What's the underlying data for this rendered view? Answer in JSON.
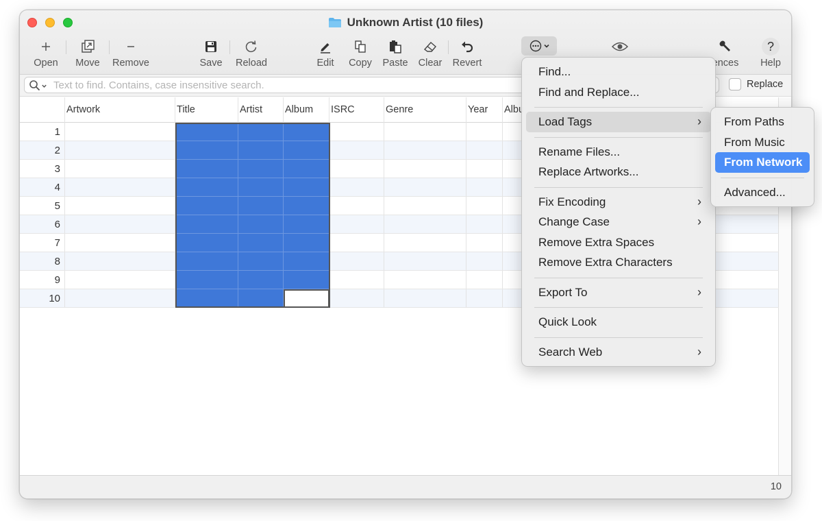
{
  "window": {
    "title": "Unknown Artist (10 files)"
  },
  "toolbar": {
    "open": "Open",
    "move": "Move",
    "remove": "Remove",
    "save": "Save",
    "reload": "Reload",
    "edit": "Edit",
    "copy": "Copy",
    "paste": "Paste",
    "clear": "Clear",
    "revert": "Revert",
    "preferences": "ences",
    "help": "Help",
    "help_icon": "?"
  },
  "search": {
    "placeholder": "Text to find. Contains, case insensitive search.",
    "replace_label": "Replace"
  },
  "table": {
    "columns": [
      "Artwork",
      "Title",
      "Artist",
      "Album",
      "ISRC",
      "Genre",
      "Year",
      "Albu"
    ],
    "rows": [
      "1",
      "2",
      "3",
      "4",
      "5",
      "6",
      "7",
      "8",
      "9",
      "10"
    ]
  },
  "status": {
    "count": "10"
  },
  "menu": {
    "items": {
      "find": "Find...",
      "find_replace": "Find and Replace...",
      "load_tags": "Load Tags",
      "rename_files": "Rename Files...",
      "replace_artworks": "Replace Artworks...",
      "fix_encoding": "Fix Encoding",
      "change_case": "Change Case",
      "remove_spaces": "Remove Extra Spaces",
      "remove_chars": "Remove Extra Characters",
      "export_to": "Export To",
      "quick_look": "Quick Look",
      "search_web": "Search Web"
    },
    "chevron": "›"
  },
  "submenu": {
    "from_paths": "From Paths",
    "from_music": "From Music",
    "from_network": "From Network",
    "advanced": "Advanced..."
  },
  "colors": {
    "selection": "#3f78d8",
    "menu_highlight": "#4c8ef7",
    "row_alt": "#f2f6fc"
  }
}
